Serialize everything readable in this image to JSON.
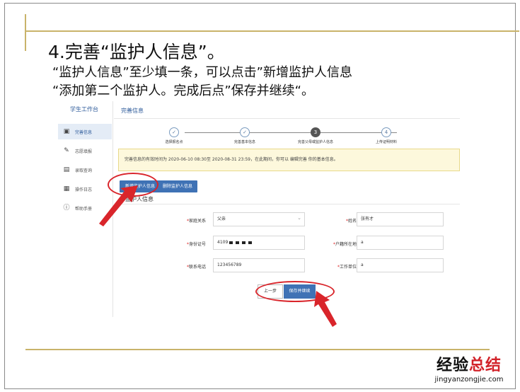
{
  "slide": {
    "heading": "4.完善“监护人信息”。",
    "sub1": "“监护人信息”至少填一条，可以点击”新增监护人信息",
    "sub2": "“添加第二个监护人。完成后点”保存并继续“。"
  },
  "app": {
    "sidebar": {
      "title": "学生工作台",
      "items": [
        {
          "label": "完善信息",
          "icon": "id-card-icon",
          "glyph": "▣"
        },
        {
          "label": "志愿填报",
          "icon": "edit-form-icon",
          "glyph": "✎"
        },
        {
          "label": "录取查询",
          "icon": "document-search-icon",
          "glyph": "▤"
        },
        {
          "label": "操作日志",
          "icon": "calendar-log-icon",
          "glyph": "▦"
        },
        {
          "label": "帮助手册",
          "icon": "info-circle-icon",
          "glyph": "ⓘ"
        }
      ]
    },
    "main": {
      "title": "完善信息",
      "steps": [
        {
          "label": "选择报名点",
          "marker": "✓"
        },
        {
          "label": "完善基本信息",
          "marker": "✓"
        },
        {
          "label": "完善父母或监护人信息",
          "marker": "3"
        },
        {
          "label": "上传证明材料",
          "marker": "4"
        }
      ],
      "notice": "完善信息的有效时间为 2020-06-10 08:30至 2020-08-31 23:59，在此期间，你可以 编辑完善 你的基本信息。",
      "buttons": {
        "add_guardian": "新增监护人信息",
        "delete_guardian": "删除监护人信息",
        "prev": "上一步",
        "save_continue": "保存并继续"
      },
      "section_title": "监护人信息",
      "form": {
        "relation_label": "家庭关系",
        "relation_value": "父亲",
        "name_label": "姓名",
        "name_value": "张有才",
        "id_label": "身份证号",
        "id_prefix": "4109",
        "hukou_label": "户籍所在地",
        "hukou_value": "a",
        "phone_label": "联系电话",
        "phone_value": "123456789",
        "work_label": "工作单位",
        "work_value": "a",
        "required_mark": "*"
      }
    }
  },
  "watermark": {
    "cn_black": "经验",
    "cn_red": "总结",
    "en": "jingyanzongjie.com"
  },
  "colors": {
    "accent_blue": "#3f72b5",
    "annotation_red": "#d9252b",
    "frame_gold": "#c9b36a",
    "notice_bg": "#fdf8dc"
  }
}
